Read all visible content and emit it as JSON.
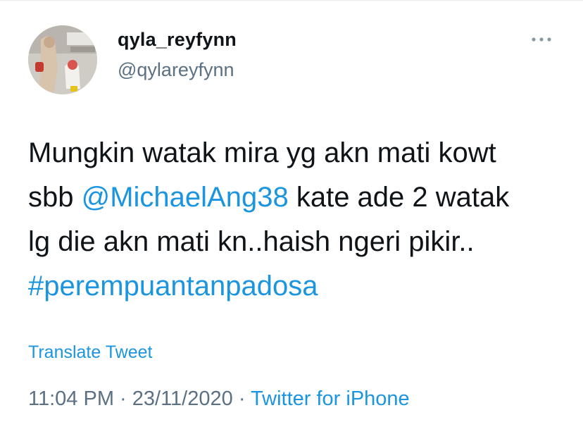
{
  "user": {
    "display_name": "qyla_reyfynn",
    "handle": "@qylareyfynn"
  },
  "more_icon": "more-dots-icon",
  "tweet": {
    "line1": "Mungkin watak mira yg akn mati kowt",
    "line2_prefix": "sbb ",
    "mention": "@MichaelAng38",
    "line2_suffix": " kate ade 2 watak",
    "line3": "lg die akn mati kn..haish ngeri pikir..",
    "hashtag": "#perempuantanpadosa"
  },
  "translate_label": "Translate Tweet",
  "meta": {
    "time": "11:04 PM",
    "sep1": " · ",
    "date": "23/11/2020",
    "sep2": " · ",
    "source": "Twitter for iPhone"
  },
  "colors": {
    "link": "#1b95e0",
    "secondary": "#5b7083",
    "text": "#0f1419"
  }
}
